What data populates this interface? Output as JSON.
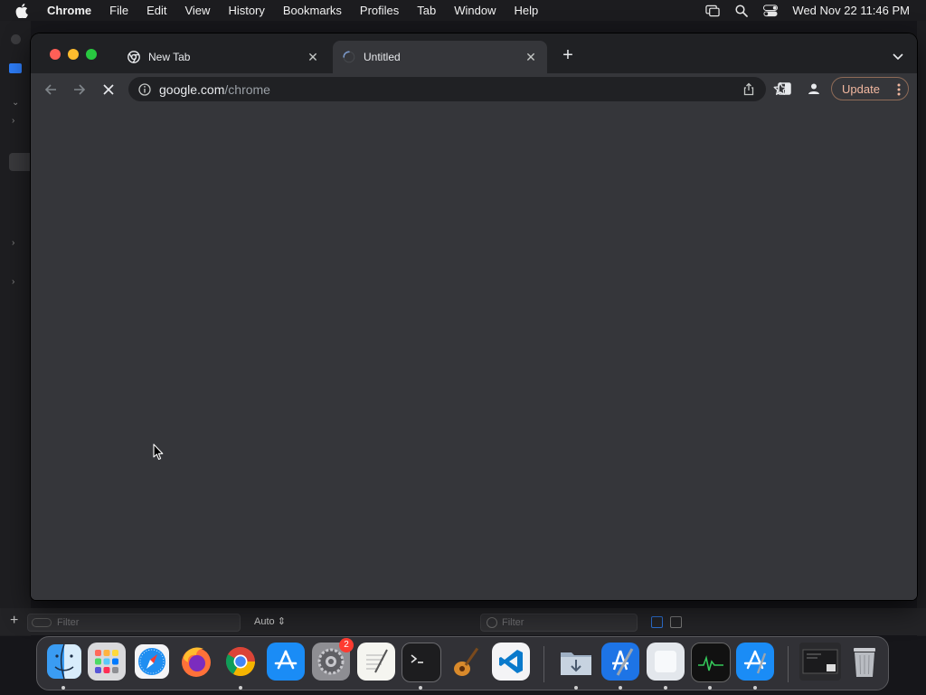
{
  "menubar": {
    "app_name": "Chrome",
    "items": [
      "File",
      "Edit",
      "View",
      "History",
      "Bookmarks",
      "Profiles",
      "Tab",
      "Window",
      "Help"
    ],
    "clock": "Wed Nov 22  11:46 PM"
  },
  "browser": {
    "tabs": [
      {
        "title": "New Tab",
        "active": false,
        "favicon": "chrome-icon"
      },
      {
        "title": "Untitled",
        "active": true,
        "favicon": "loading-spinner-icon"
      }
    ],
    "omnibox": {
      "host": "google.com",
      "path": "/chrome"
    },
    "update_label": "Update",
    "accent_color": "#f2b8a0"
  },
  "background_app": {
    "filter_placeholder_left": "Filter",
    "filter_placeholder_right": "Filter",
    "scheme_label": "Auto"
  },
  "dock": {
    "apps": [
      "Finder",
      "Launchpad",
      "Safari",
      "Firefox",
      "Google Chrome",
      "App Store",
      "System Settings",
      "TextEdit",
      "Terminal",
      "Instruments",
      "Visual Studio Code",
      "Downloads Folder",
      "Xcode",
      "Preview",
      "Activity Monitor",
      "Simulator",
      "Screenshot",
      "Trash"
    ],
    "settings_badge": "2"
  }
}
